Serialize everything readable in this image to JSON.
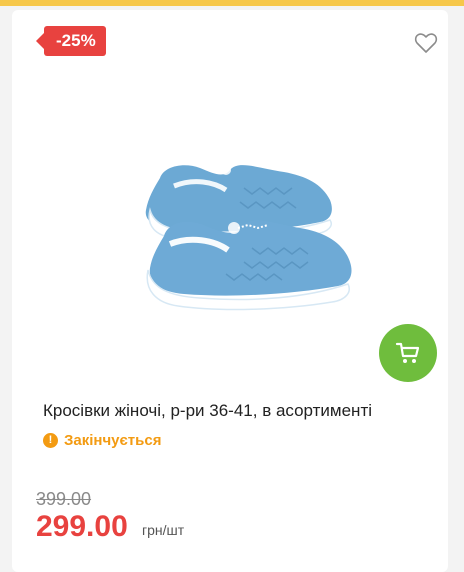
{
  "product": {
    "discount_badge": "-25%",
    "title": "Кросівки жіночі, р-ри 36-41, в асортименті",
    "stock_status": "Закінчується",
    "old_price": "399.00",
    "price": "299.00",
    "unit": "грн/шт"
  },
  "colors": {
    "badge": "#e8423f",
    "cart_button": "#6fbd3d",
    "stock_status": "#f39b12",
    "price": "#e8423f"
  },
  "icons": {
    "wishlist": "heart-icon",
    "cart": "cart-icon",
    "stock": "exclamation-circle-icon"
  }
}
